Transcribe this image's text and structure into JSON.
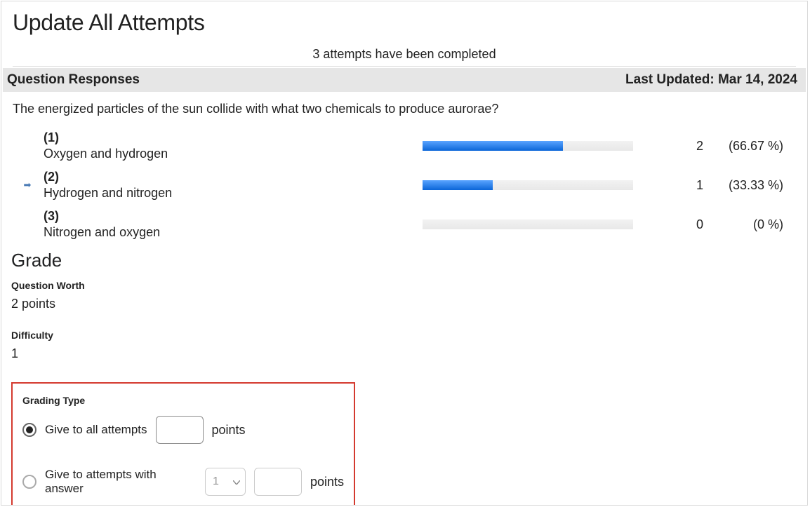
{
  "title": "Update All Attempts",
  "attempts_status": "3 attempts have been completed",
  "section": {
    "heading": "Question Responses",
    "last_updated_label": "Last Updated: Mar 14, 2024"
  },
  "question_text": "The energized particles of the sun collide with what two chemicals to produce aurorae?",
  "responses": [
    {
      "num": "(1)",
      "text": "Oxygen and hydrogen",
      "count": "2",
      "pct": "(66.67 %)",
      "bar_pct": 66.67,
      "indicator": false
    },
    {
      "num": "(2)",
      "text": "Hydrogen and nitrogen",
      "count": "1",
      "pct": "(33.33 %)",
      "bar_pct": 33.33,
      "indicator": true
    },
    {
      "num": "(3)",
      "text": "Nitrogen and oxygen",
      "count": "0",
      "pct": "(0 %)",
      "bar_pct": 0,
      "indicator": false
    }
  ],
  "grade": {
    "heading": "Grade",
    "worth_label": "Question Worth",
    "worth_value": "2 points",
    "difficulty_label": "Difficulty",
    "difficulty_value": "1"
  },
  "grading_type": {
    "label": "Grading Type",
    "option_all_label": "Give to all attempts",
    "option_all_points_suffix": "points",
    "option_answer_label": "Give to attempts with answer",
    "option_answer_select_value": "1",
    "option_answer_points_suffix": "points",
    "selected": "all"
  }
}
